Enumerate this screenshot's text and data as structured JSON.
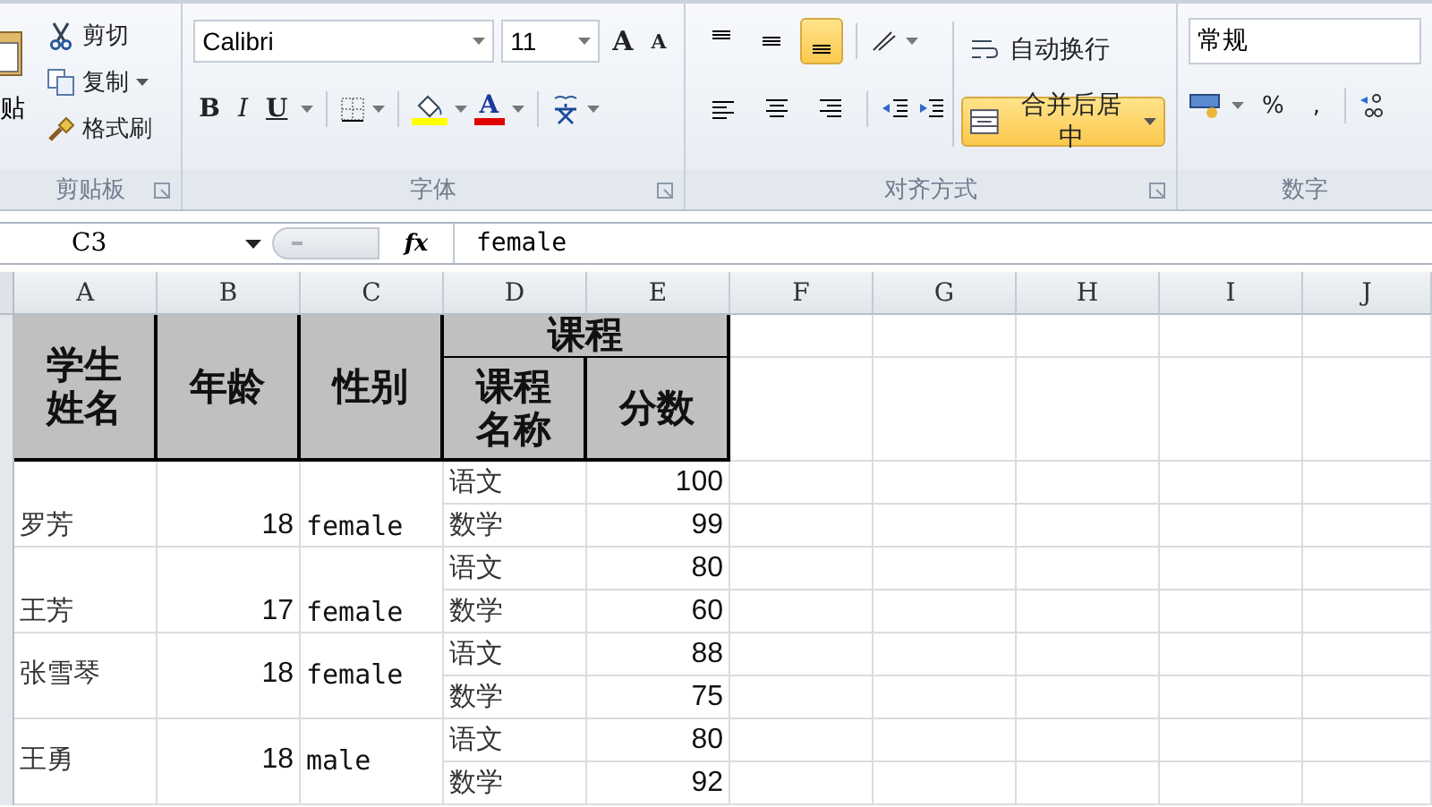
{
  "ribbon": {
    "clipboard": {
      "paste_label": "贴",
      "items": [
        {
          "kind": "cut",
          "label": "剪切",
          "dropdown": false
        },
        {
          "kind": "copy",
          "label": "复制",
          "dropdown": true
        },
        {
          "kind": "brush",
          "label": "格式刷",
          "dropdown": false
        }
      ],
      "group_label": "剪贴板"
    },
    "font": {
      "font_name": "Calibri",
      "font_size": "11",
      "grow": "A",
      "shrink": "A",
      "bold": "B",
      "italic": "I",
      "underline": "U",
      "font_color": "A",
      "group_label": "字体"
    },
    "alignment": {
      "vertical": [
        {
          "kind": "top",
          "selected": false
        },
        {
          "kind": "middle",
          "selected": false
        },
        {
          "kind": "bottom",
          "selected": true
        }
      ],
      "horizontal": [
        {
          "kind": "left",
          "selected": false
        },
        {
          "kind": "center",
          "selected": false
        },
        {
          "kind": "right",
          "selected": false
        }
      ],
      "wrap": {
        "label": "自动换行",
        "selected": false
      },
      "merge": {
        "label": "合并后居中",
        "selected": true
      },
      "group_label": "对齐方式"
    },
    "number": {
      "format": "常规",
      "percent": "%",
      "comma": ",",
      "group_label": "数字"
    }
  },
  "formula_bar": {
    "name_box": "C3",
    "fx": "fx",
    "value": "female"
  },
  "columns": [
    "A",
    "B",
    "C",
    "D",
    "E",
    "F",
    "G",
    "H",
    "I",
    "J"
  ],
  "table": {
    "header": {
      "name": "学生姓名",
      "age": "年龄",
      "gender": "性别",
      "course_group": "课程",
      "course_name": "课程名称",
      "score": "分数"
    },
    "students": [
      {
        "name": "罗芳",
        "age": "18",
        "gender": "female",
        "scores": [
          {
            "course": "语文",
            "score": "100"
          },
          {
            "course": "数学",
            "score": "99"
          }
        ]
      },
      {
        "name": "王芳",
        "age": "17",
        "gender": "female",
        "scores": [
          {
            "course": "语文",
            "score": "80"
          },
          {
            "course": "数学",
            "score": "60"
          }
        ]
      },
      {
        "name": "张雪琴",
        "age": "18",
        "gender": "female",
        "scores": [
          {
            "course": "语文",
            "score": "88"
          },
          {
            "course": "数学",
            "score": "75"
          }
        ]
      },
      {
        "name": "王勇",
        "age": "18",
        "gender": "male",
        "scores": [
          {
            "course": "语文",
            "score": "80"
          },
          {
            "course": "数学",
            "score": "92"
          }
        ]
      }
    ]
  }
}
